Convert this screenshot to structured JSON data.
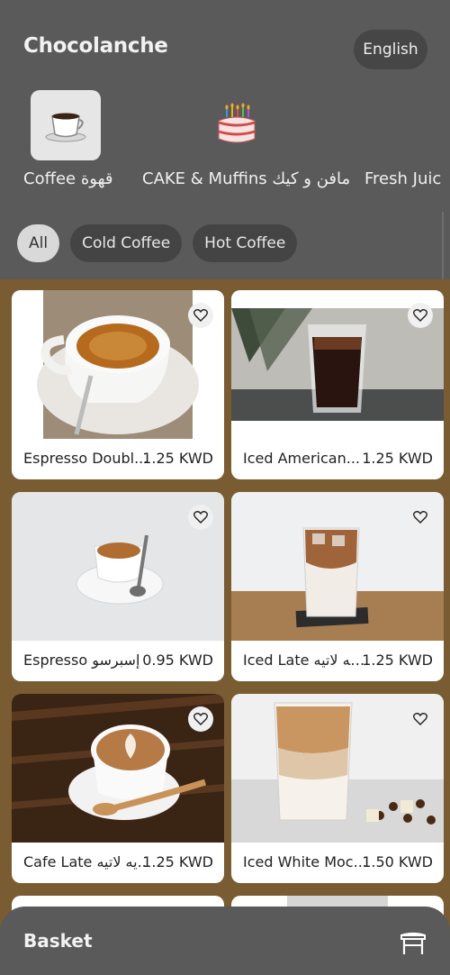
{
  "header": {
    "brand": "Chocolanche",
    "language_button": "English"
  },
  "categories": [
    {
      "label": "Coffee قهوة",
      "icon": "coffee-cup-icon",
      "active": true
    },
    {
      "label": "CAKE & Muffins مافن و كيك",
      "icon": "birthday-cake-icon",
      "active": false
    },
    {
      "label": "Fresh Juic",
      "icon": "juice-icon",
      "active": false
    }
  ],
  "filters": [
    {
      "label": "All",
      "active": true
    },
    {
      "label": "Cold Coffee",
      "active": false
    },
    {
      "label": "Hot Coffee",
      "active": false
    }
  ],
  "products": [
    {
      "name": "Espresso Doubl...",
      "price": "1.25 KWD",
      "favorite_icon": "heart-outline-icon"
    },
    {
      "name": "Iced American...",
      "price": "1.25 KWD",
      "favorite_icon": "heart-outline-icon"
    },
    {
      "name": "Espresso إسبرسو",
      "price": "0.95 KWD",
      "favorite_icon": "heart-outline-icon"
    },
    {
      "name": "Iced Late فيه لاتيه..",
      "price": "1.25 KWD",
      "favorite_icon": "heart-outline-icon"
    },
    {
      "name": "Cafe Late يه لاتيه..",
      "price": "1.25 KWD",
      "favorite_icon": "heart-outline-icon"
    },
    {
      "name": "Iced White Moc...",
      "price": "1.50 KWD",
      "favorite_icon": "heart-outline-icon"
    }
  ],
  "basket": {
    "label": "Basket",
    "icon": "basket-table-icon"
  },
  "colors": {
    "background": "#5a5a5a",
    "grid_background": "#7a5c32",
    "chip": "#444444",
    "chip_active": "#d9d9d9"
  }
}
